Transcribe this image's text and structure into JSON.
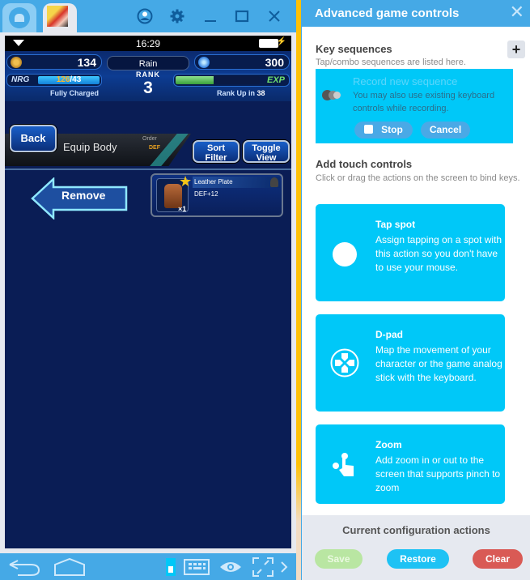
{
  "window": {
    "tabs": [
      {
        "name": "home",
        "icon": "home-icon"
      },
      {
        "name": "game",
        "icon": "app-icon"
      }
    ],
    "title_icons": [
      "account-icon",
      "gear-icon",
      "minimize-icon",
      "maximize-icon",
      "close-icon"
    ]
  },
  "statusbar": {
    "time": "16:29"
  },
  "hud": {
    "gold": "134",
    "gems": "300",
    "player_name": "Rain",
    "rank_label": "RANK",
    "rank": "3",
    "nrg_label": "NRG",
    "nrg_current": "126",
    "nrg_max": "/43",
    "nrg_status": "Fully Charged",
    "exp_label": "EXP",
    "exp_progress_percent": 45,
    "rank_up_text": "Rank Up in",
    "rank_up_value": "38"
  },
  "game": {
    "back_label": "Back",
    "screen_title": "Equip Body",
    "order_label": "Order",
    "order_value": "DEF",
    "sort_filter": [
      "Sort",
      "Filter"
    ],
    "toggle_view": [
      "Toggle",
      "View"
    ],
    "remove_label": "Remove",
    "item": {
      "name": "Leather Plate",
      "stat": "DEF+12",
      "rarity": "1",
      "quantity": "×1"
    }
  },
  "navbar": {
    "icons": [
      "back-icon",
      "home-icon",
      "lock-icon",
      "keyboard-icon",
      "eye-icon",
      "fullscreen-icon",
      "chevron-right-icon"
    ]
  },
  "panel": {
    "title": "Advanced game controls",
    "key_sequences": {
      "title": "Key sequences",
      "subtitle": "Tap/combo sequences are listed here.",
      "record_title": "Record new sequence",
      "record_desc": "You may also use existing keyboard controls while recording.",
      "stop_label": "Stop",
      "cancel_label": "Cancel"
    },
    "touch_controls": {
      "title": "Add touch controls",
      "subtitle": "Click or drag the actions on the screen to bind keys.",
      "cards": [
        {
          "title": "Tap spot",
          "desc": "Assign tapping on a spot with this action so you don't have to use your mouse.",
          "icon": "tap-spot-icon"
        },
        {
          "title": "D-pad",
          "desc": "Map the movement of your character or the game analog stick with the keyboard.",
          "icon": "dpad-icon"
        },
        {
          "title": "Zoom",
          "desc": "Add zoom in or out to the screen that supports pinch to zoom",
          "icon": "pinch-zoom-icon"
        }
      ]
    },
    "footer": {
      "title": "Current configuration actions",
      "save_label": "Save",
      "restore_label": "Restore",
      "clear_label": "Clear"
    }
  }
}
